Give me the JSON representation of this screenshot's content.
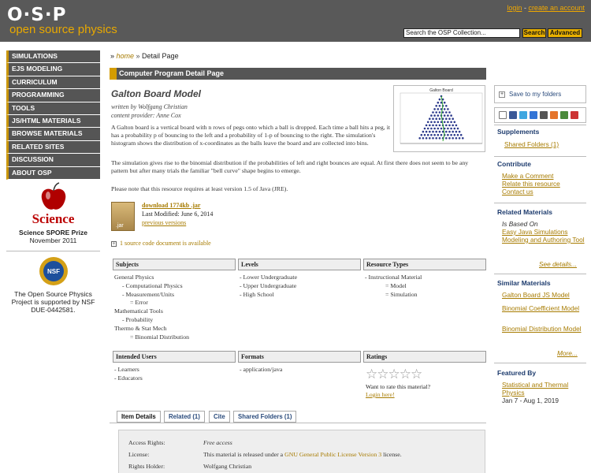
{
  "header": {
    "logo_top": "O·S·P",
    "logo_bottom": "open source physics",
    "login": "login",
    "separator": " - ",
    "create_account": "create an account",
    "search_value": "Search the OSP Collection...",
    "search_button": "Search",
    "advanced_button": "Advanced"
  },
  "nav": {
    "items": [
      "SIMULATIONS",
      "EJS MODELING",
      "CURRICULUM",
      "PROGRAMMING",
      "TOOLS",
      "JS/HTML MATERIALS",
      "BROWSE MATERIALS",
      "RELATED SITES",
      "DISCUSSION",
      "ABOUT OSP"
    ]
  },
  "award": {
    "logo_text": "Science",
    "line1": "Science SPORE Prize",
    "line2": "November 2011"
  },
  "nsf": {
    "logo_text": "NSF",
    "text": "The Open Source Physics Project is supported by NSF DUE-0442581."
  },
  "breadcrumb": {
    "prefix": "» ",
    "home": "home",
    "sep": " » ",
    "current": "Detail Page"
  },
  "section_title": "Computer Program Detail Page",
  "resource": {
    "title": "Galton Board Model",
    "written_by": "written by Wolfgang Christian",
    "provider": "content provider: Anne Cox",
    "thumb_title": "Galton Board",
    "p1": "A Galton board is a vertical board with n rows of pegs onto which a ball is dropped.   Each time a ball hits a peg, it has a probability p of bouncing to the left and a probability of 1-p of bouncing to the right. The simulation's histogram shows the distribution of x-coordinates as the balls leave the board and are collected into bins.",
    "p2": "The simulation gives rise to the binomial distribution if the probabilities of left and right bounces are equal. At first there does not seem to be any pattern but after many trials the familiar \"bell curve\" shape begins to emerge.",
    "p3": "Please note that this resource requires at least version 1.5 of Java (JRE).",
    "jar_label": ".jar",
    "download": "download 1774kb .jar",
    "last_modified": "Last Modified: June 6, 2014",
    "previous_versions": "previous versions",
    "source_doc": "1 source code document is available"
  },
  "columns": {
    "subjects_head": "Subjects",
    "levels_head": "Levels",
    "types_head": "Resource Types",
    "subjects": [
      {
        "text": "General Physics",
        "lvl": 0
      },
      {
        "text": "- Computational Physics",
        "lvl": 1
      },
      {
        "text": "- Measurement/Units",
        "lvl": 1
      },
      {
        "text": "= Error",
        "lvl": 2
      },
      {
        "text": "Mathematical Tools",
        "lvl": 0
      },
      {
        "text": "- Probability",
        "lvl": 1
      },
      {
        "text": "Thermo & Stat Mech",
        "lvl": 0
      },
      {
        "text": "= Binomial Distribution",
        "lvl": 2
      }
    ],
    "levels": [
      "- Lower Undergraduate",
      "- Upper Undergraduate",
      "- High School"
    ],
    "types": [
      {
        "text": "- Instructional Material",
        "lvl": 0
      },
      {
        "text": "= Model",
        "lvl": 3
      },
      {
        "text": "= Simulation",
        "lvl": 3
      }
    ],
    "users_head": "Intended Users",
    "formats_head": "Formats",
    "ratings_head": "Ratings",
    "users": [
      "- Learners",
      "- Educators"
    ],
    "formats": [
      "- application/java"
    ],
    "stars": "☆☆☆☆☆",
    "rate_question": "Want to rate this material?",
    "login_here": "Login here!"
  },
  "tabs": [
    "Item Details",
    "Related (1)",
    "Cite",
    "Shared Folders (1)"
  ],
  "details": {
    "rows": [
      {
        "label": "Access Rights:",
        "value": "Free access"
      },
      {
        "label": "License:",
        "value_pre": "This material is released under a ",
        "link": "GNU General Public License Version 3",
        "value_post": " license."
      },
      {
        "label": "Rights Holder:",
        "value": "Wolfgang Christian"
      }
    ]
  },
  "sidebar": {
    "save": "Save to my folders",
    "supplements_head": "Supplements",
    "shared_folders": "Shared Folders (1)",
    "contribute_head": "Contribute",
    "make_comment": "Make a Comment",
    "relate": "Relate this resource",
    "contact": "Contact us",
    "related_head": "Related Materials",
    "is_based_on": "Is Based On",
    "ejs_link": "Easy Java Simulations Modeling and Authoring Tool",
    "see_details": "See details...",
    "similar_head": "Similar Materials",
    "similar": [
      "Galton Board JS Model",
      "Binomial Coefficient Model",
      "Binomial Distribution Model"
    ],
    "more": "More...",
    "featured_head": "Featured By",
    "featured_link": "Statistical and Thermal Physics",
    "featured_dates": "Jan 7 - Aug 1, 2019"
  },
  "colors": {
    "accent": "#d49c00",
    "link": "#a77b00",
    "header_bg": "#595959",
    "sidebar_head": "#1e3c6e"
  }
}
